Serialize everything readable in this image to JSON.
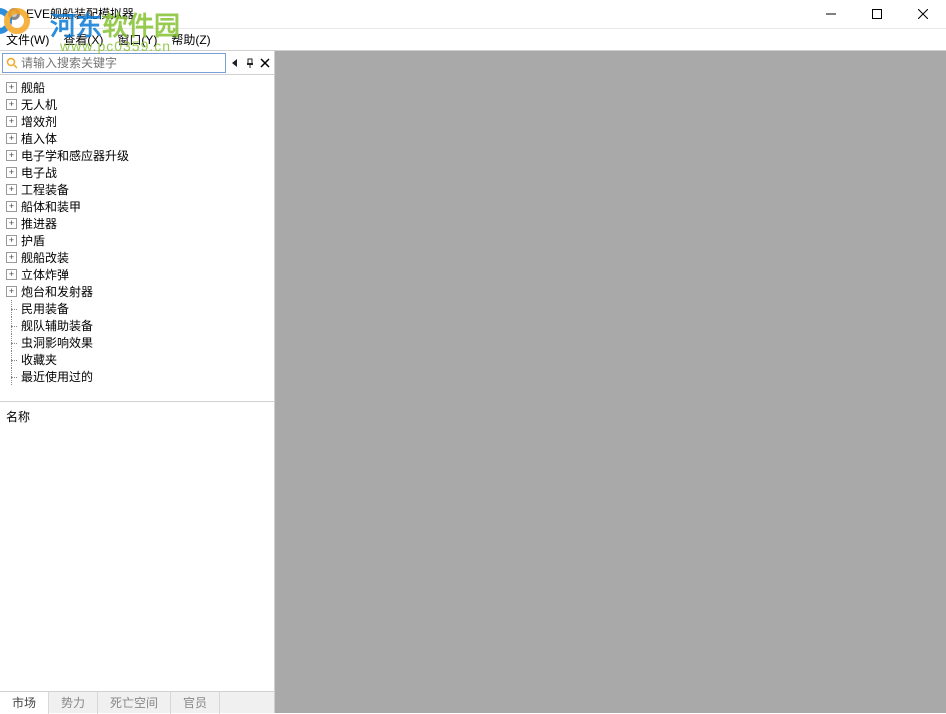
{
  "window": {
    "title": "EVE舰船装配模拟器"
  },
  "watermark": {
    "text1": "河东",
    "text2": "软件园",
    "url": "www.pc0359.cn"
  },
  "menu": {
    "file": "文件(W)",
    "view": "查看(X)",
    "window": "窗口(Y)",
    "help": "帮助(Z)"
  },
  "search": {
    "placeholder": "请输入搜索关键字"
  },
  "tree": {
    "items": [
      {
        "label": "舰船",
        "expandable": true
      },
      {
        "label": "无人机",
        "expandable": true
      },
      {
        "label": "增效剂",
        "expandable": true
      },
      {
        "label": "植入体",
        "expandable": true
      },
      {
        "label": "电子学和感应器升级",
        "expandable": true
      },
      {
        "label": "电子战",
        "expandable": true
      },
      {
        "label": "工程装备",
        "expandable": true
      },
      {
        "label": "船体和装甲",
        "expandable": true
      },
      {
        "label": "推进器",
        "expandable": true
      },
      {
        "label": "护盾",
        "expandable": true
      },
      {
        "label": "舰船改装",
        "expandable": true
      },
      {
        "label": "立体炸弹",
        "expandable": true
      },
      {
        "label": "炮台和发射器",
        "expandable": true
      },
      {
        "label": "民用装备",
        "expandable": false
      },
      {
        "label": "舰队辅助装备",
        "expandable": false
      },
      {
        "label": "虫洞影响效果",
        "expandable": false
      },
      {
        "label": "收藏夹",
        "expandable": false
      },
      {
        "label": "最近使用过的",
        "expandable": false
      }
    ]
  },
  "detail": {
    "header": "名称"
  },
  "bottom_tabs": {
    "items": [
      "市场",
      "势力",
      "死亡空间",
      "官员"
    ]
  }
}
